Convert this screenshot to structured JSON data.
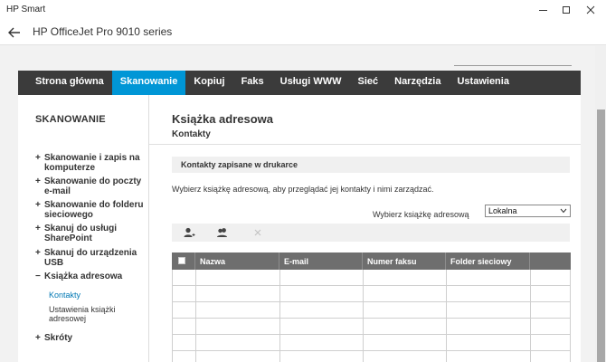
{
  "app": {
    "title": "HP Smart"
  },
  "header": {
    "printer_name": "HP OfficeJet Pro 9010 series"
  },
  "nav": {
    "items": [
      {
        "label": "Strona główna",
        "active": false
      },
      {
        "label": "Skanowanie",
        "active": true
      },
      {
        "label": "Kopiuj",
        "active": false
      },
      {
        "label": "Faks",
        "active": false
      },
      {
        "label": "Usługi WWW",
        "active": false
      },
      {
        "label": "Sieć",
        "active": false
      },
      {
        "label": "Narzędzia",
        "active": false
      },
      {
        "label": "Ustawienia",
        "active": false
      }
    ]
  },
  "sidebar": {
    "title": "SKANOWANIE",
    "items": [
      {
        "sign": "+",
        "label": "Skanowanie i zapis na komputerze"
      },
      {
        "sign": "+",
        "label": "Skanowanie do poczty e-mail"
      },
      {
        "sign": "+",
        "label": "Skanowanie do folderu sieciowego"
      },
      {
        "sign": "+",
        "label": "Skanuj do usługi SharePoint"
      },
      {
        "sign": "+",
        "label": "Skanuj do urządzenia USB"
      },
      {
        "sign": "−",
        "label": "Książka adresowa"
      },
      {
        "sign": "+",
        "label": "Skróty"
      }
    ],
    "subitems": [
      {
        "label": "Kontakty",
        "active": true
      },
      {
        "label": "Ustawienia książki adresowej",
        "active": false
      }
    ]
  },
  "main": {
    "title": "Książka adresowa",
    "subtitle": "Kontakty",
    "section_title": "Kontakty zapisane w drukarce",
    "description": "Wybierz książkę adresową, aby przeglądać jej kontakty i nimi zarządzać.",
    "select_label": "Wybierz książkę adresową",
    "select_value": "Lokalna",
    "table": {
      "columns": [
        "Nazwa",
        "E-mail",
        "Numer faksu",
        "Folder sieciowy"
      ],
      "empty_rows": 6
    }
  },
  "colors": {
    "accent": "#0096d6",
    "nav_bg": "#3b3b3b",
    "link": "#0078b4",
    "table_header": "#6e6e6e"
  },
  "icons": {
    "back": "arrow-left-icon",
    "add_contact": "add-contact-icon",
    "add_group": "add-group-icon",
    "delete": "delete-icon"
  }
}
